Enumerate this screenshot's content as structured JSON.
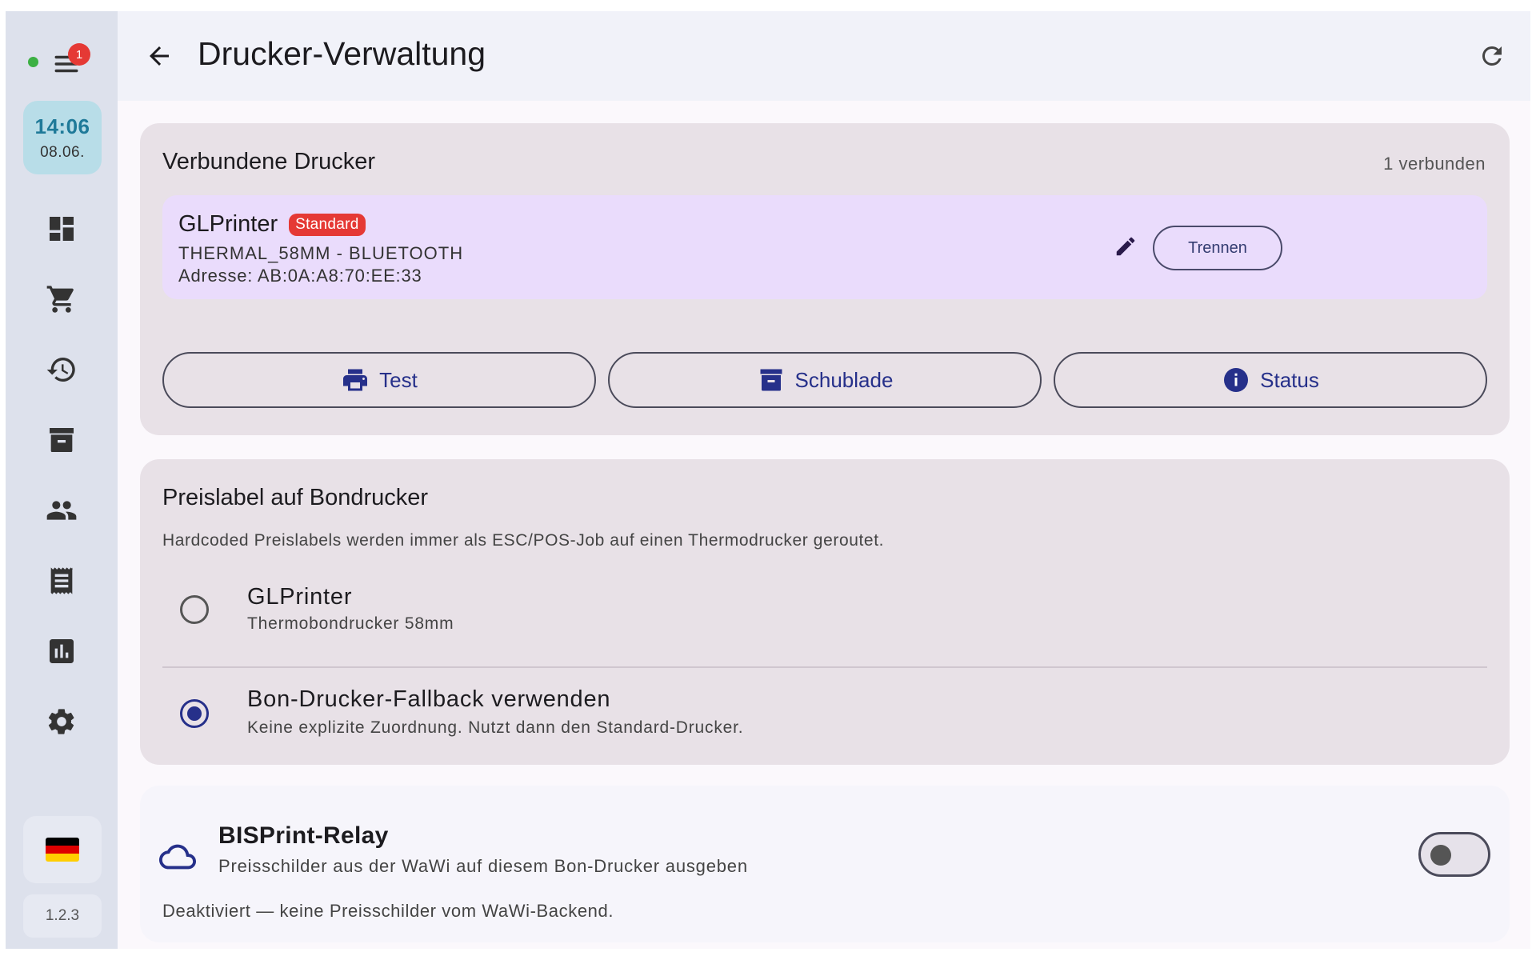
{
  "sidebar": {
    "notification_count": "1",
    "clock": {
      "time": "14:06",
      "date": "08.06."
    },
    "nav_items": [
      "dashboard",
      "cart",
      "history",
      "archive",
      "customers",
      "receipts",
      "reports",
      "settings"
    ],
    "language_flag": "de-flag-icon",
    "version": "1.2.3",
    "status_color": "#3cb043"
  },
  "header": {
    "title": "Drucker-Verwaltung"
  },
  "connected_printers": {
    "title": "Verbundene Drucker",
    "count_label": "1 verbunden",
    "printer": {
      "name": "GLPrinter",
      "badge": "Standard",
      "type": "THERMAL_58MM - BLUETOOTH",
      "address": "Adresse: AB:0A:A8:70:EE:33",
      "disconnect_label": "Trennen"
    },
    "actions": {
      "test": "Test",
      "drawer": "Schublade",
      "status": "Status"
    }
  },
  "price_label": {
    "title": "Preislabel auf Bondrucker",
    "description": "Hardcoded Preislabels werden immer als ESC/POS-Job auf einen Thermodrucker geroutet.",
    "options": [
      {
        "label": "GLPrinter",
        "sub": "Thermobondrucker 58mm",
        "selected": false
      },
      {
        "label": "Bon-Drucker-Fallback verwenden",
        "sub": "Keine explizite Zuordnung. Nutzt dann den Standard-Drucker.",
        "selected": true
      }
    ]
  },
  "relay": {
    "title": "BISPrint-Relay",
    "subtitle": "Preisschilder aus der WaWi auf diesem Bon-Drucker ausgeben",
    "status": "Deaktiviert — keine Preisschilder vom WaWi-Backend.",
    "enabled": false
  },
  "colors": {
    "accent": "#26308a",
    "badge": "#e53935",
    "printer_highlight": "#eadcfc",
    "card_bg": "#e8e1e7",
    "sidebar_bg": "#dde1ec"
  }
}
